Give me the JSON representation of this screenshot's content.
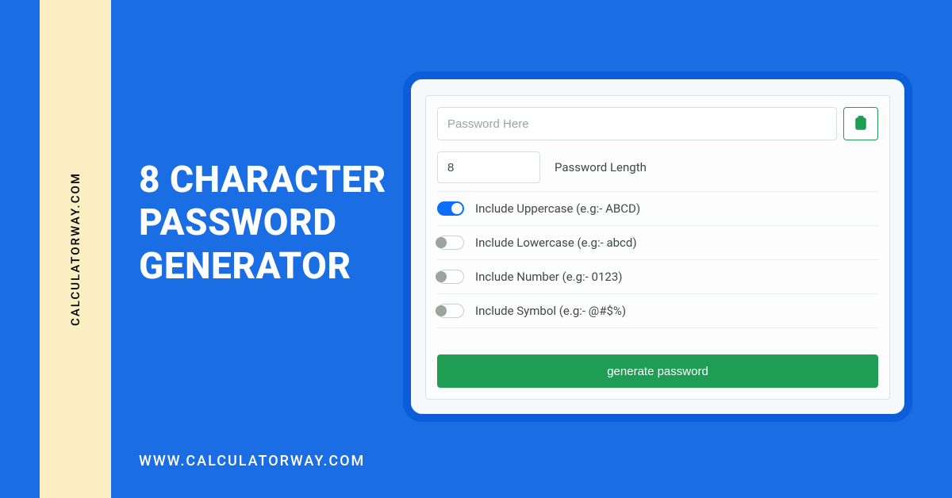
{
  "brand": {
    "domain_vertical": "CALCULATORWAY.COM",
    "footer_url": "WWW.CALCULATORWAY.COM"
  },
  "hero": {
    "title_line1": "8 CHARACTER",
    "title_line2": "PASSWORD",
    "title_line3": "GENERATOR"
  },
  "form": {
    "password_placeholder": "Password Here",
    "password_value": "",
    "length_value": "8",
    "length_label": "Password Length",
    "options": {
      "uppercase": {
        "label": "Include Uppercase (e.g:- ABCD)",
        "on": true
      },
      "lowercase": {
        "label": "Include Lowercase (e.g:- abcd)",
        "on": false
      },
      "number": {
        "label": "Include Number (e.g:- 0123)",
        "on": false
      },
      "symbol": {
        "label": "Include Symbol (e.g:- @#$%)",
        "on": false
      }
    },
    "generate_label": "generate password"
  },
  "colors": {
    "bg": "#1b6de3",
    "cream": "#fbeec2",
    "card_border": "#0b5ed7",
    "accent_green": "#1f9d55",
    "toggle_blue": "#0d6efd"
  }
}
